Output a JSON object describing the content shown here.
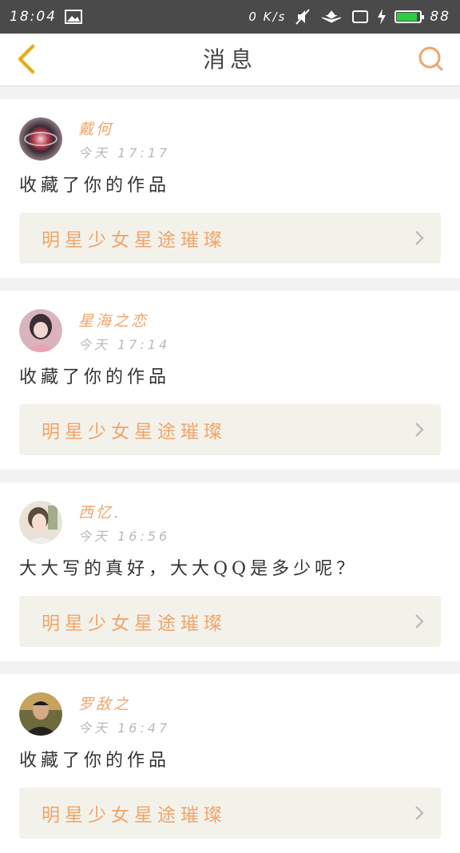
{
  "status_bar": {
    "time": "18:04",
    "net_speed": "0 K/s",
    "battery_level": "88",
    "battery_fraction": 0.88,
    "icons": [
      "image-icon",
      "mute-icon",
      "signal-icon",
      "tablet-icon",
      "charging-icon",
      "battery-icon"
    ]
  },
  "header": {
    "title": "消息",
    "back_icon": "chevron-left-icon",
    "search_icon": "search-icon"
  },
  "colors": {
    "accent": "#f0a46a",
    "back_icon": "#f5c02c",
    "status_bar_bg": "#4a4a4a",
    "card_link_bg": "#f3f2ea"
  },
  "messages": [
    {
      "username": "戴何",
      "time": "今天 17:17",
      "text": "收藏了你的作品",
      "work_title": "明星少女星途璀璨",
      "avatar": "avatar-image"
    },
    {
      "username": "星海之恋",
      "time": "今天 17:14",
      "text": "收藏了你的作品",
      "work_title": "明星少女星途璀璨",
      "avatar": "avatar-image"
    },
    {
      "username": "西忆.",
      "time": "今天 16:56",
      "text": "大大写的真好，大大QQ是多少呢？",
      "work_title": "明星少女星途璀璨",
      "avatar": "avatar-image"
    },
    {
      "username": "罗敌之",
      "time": "今天 16:47",
      "text": "收藏了你的作品",
      "work_title": "明星少女星途璀璨",
      "avatar": "avatar-image"
    }
  ]
}
